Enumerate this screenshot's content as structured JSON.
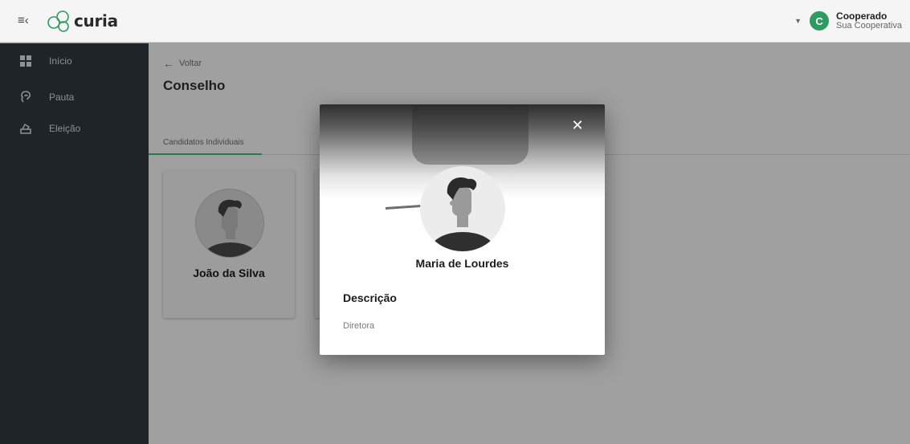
{
  "header": {
    "brand": "curia",
    "user_initial": "C",
    "user_name": "Cooperado",
    "user_cooperative": "Sua Cooperativa"
  },
  "sidebar": {
    "items": [
      {
        "label": "Início",
        "icon": "dashboard-icon"
      },
      {
        "label": "Pauta",
        "icon": "ear-icon"
      },
      {
        "label": "Eleição",
        "icon": "ballot-box-icon"
      }
    ]
  },
  "main": {
    "back_label": "Voltar",
    "title": "Conselho",
    "tabs": [
      {
        "label": "Candidatos Individuais",
        "active": true
      }
    ],
    "candidates": [
      {
        "name": "João da Silva"
      }
    ]
  },
  "modal": {
    "candidate_name": "Maria de Lourdes",
    "description_title": "Descrição",
    "description_text": "Diretora"
  },
  "colors": {
    "accent_green": "#2e9b5f",
    "sidebar_bg": "#1e2427"
  }
}
